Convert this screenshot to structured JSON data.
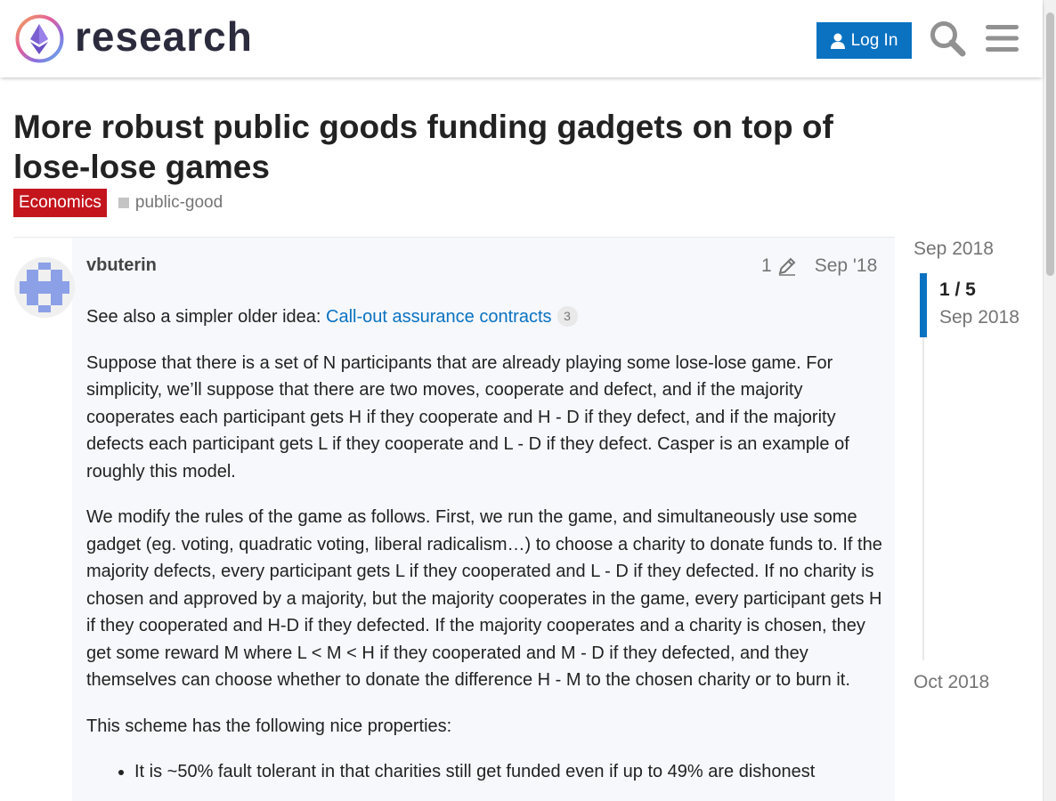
{
  "header": {
    "logo_text": "research",
    "login_label": "Log In",
    "search_icon": "search-icon",
    "menu_icon": "hamburger-menu-icon"
  },
  "topic": {
    "title": "More robust public goods funding gadgets on top of lose-lose games",
    "category": "Economics",
    "tag": "public-good",
    "colors": {
      "category": "#c4151d",
      "accent": "#0a72c1"
    }
  },
  "post": {
    "username": "vbuterin",
    "edit_count": "1",
    "date": "Sep '18",
    "intro_text": "See also a simpler older idea: ",
    "intro_link": "Call-out assurance contracts",
    "intro_link_count": "3",
    "paragraphs": [
      "Suppose that there is a set of N participants that are already playing some lose-lose game. For simplicity, we’ll suppose that there are two moves, cooperate and defect, and if the majority cooperates each participant gets H if they cooperate and H - D if they defect, and if the majority defects each participant gets L if they cooperate and L - D if they defect. Casper is an example of roughly this model.",
      "We modify the rules of the game as follows. First, we run the game, and simultaneously use some gadget (eg. voting, quadratic voting, liberal radicalism…) to choose a charity to donate funds to. If the majority defects, every participant gets L if they cooperated and L - D if they defected. If no charity is chosen and approved by a majority, but the majority cooperates in the game, every participant gets H if they cooperated and H-D if they defected. If the majority cooperates and a charity is chosen, they get some reward M where L < M < H if they cooperated and M - D if they defected, and they themselves can choose whether to donate the difference H - M to the chosen charity or to burn it.",
      "This scheme has the following nice properties:"
    ],
    "list_items": [
      "It is ~50% fault tolerant in that charities still get funded even if up to 49% are dishonest"
    ]
  },
  "timeline": {
    "start_date": "Sep 2018",
    "position": "1 / 5",
    "position_date": "Sep 2018",
    "end_date": "Oct 2018"
  }
}
